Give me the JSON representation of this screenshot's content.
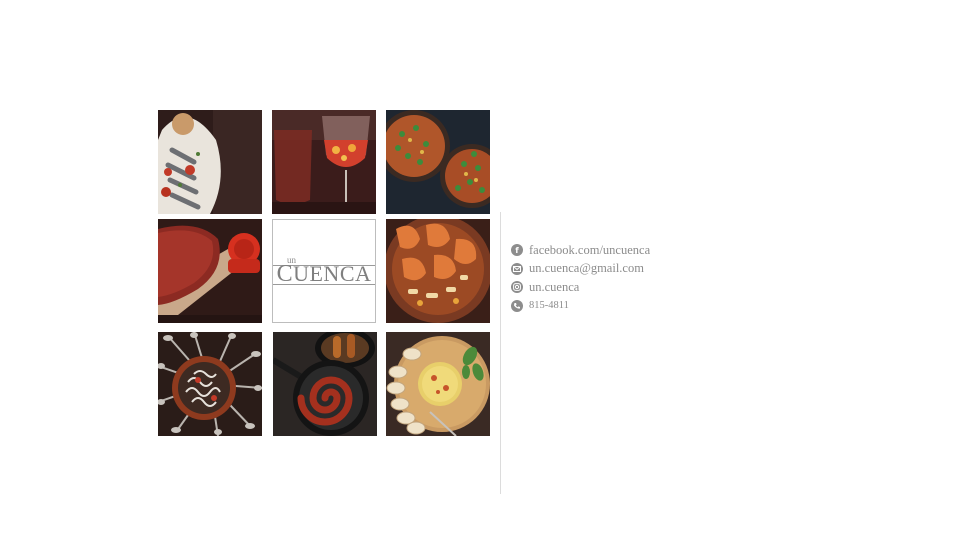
{
  "logo": {
    "small_text": "un",
    "main_initial": "C",
    "main_rest": "UENCA"
  },
  "photos": [
    {
      "icon": "photo-grilled-sardines"
    },
    {
      "icon": "photo-sangria-glass"
    },
    {
      "icon": "photo-paella-pans"
    },
    {
      "icon": "photo-cured-ham"
    },
    {
      "icon": "photo-garlic-shrimp"
    },
    {
      "icon": "photo-baby-eels-cazuela"
    },
    {
      "icon": "photo-chorizo-skillet"
    },
    {
      "icon": "photo-tortilla-bread-board"
    }
  ],
  "contacts": [
    {
      "icon": "facebook-icon",
      "text": "facebook.com/uncuenca"
    },
    {
      "icon": "email-icon",
      "text": "un.cuenca@gmail.com"
    },
    {
      "icon": "instagram-icon",
      "text": "un.cuenca"
    },
    {
      "icon": "phone-icon",
      "text": "815-4811"
    }
  ],
  "colors": {
    "text": "#8c8c8c",
    "icon_bg": "#8d8d8d",
    "divider": "#dcdcdc"
  }
}
